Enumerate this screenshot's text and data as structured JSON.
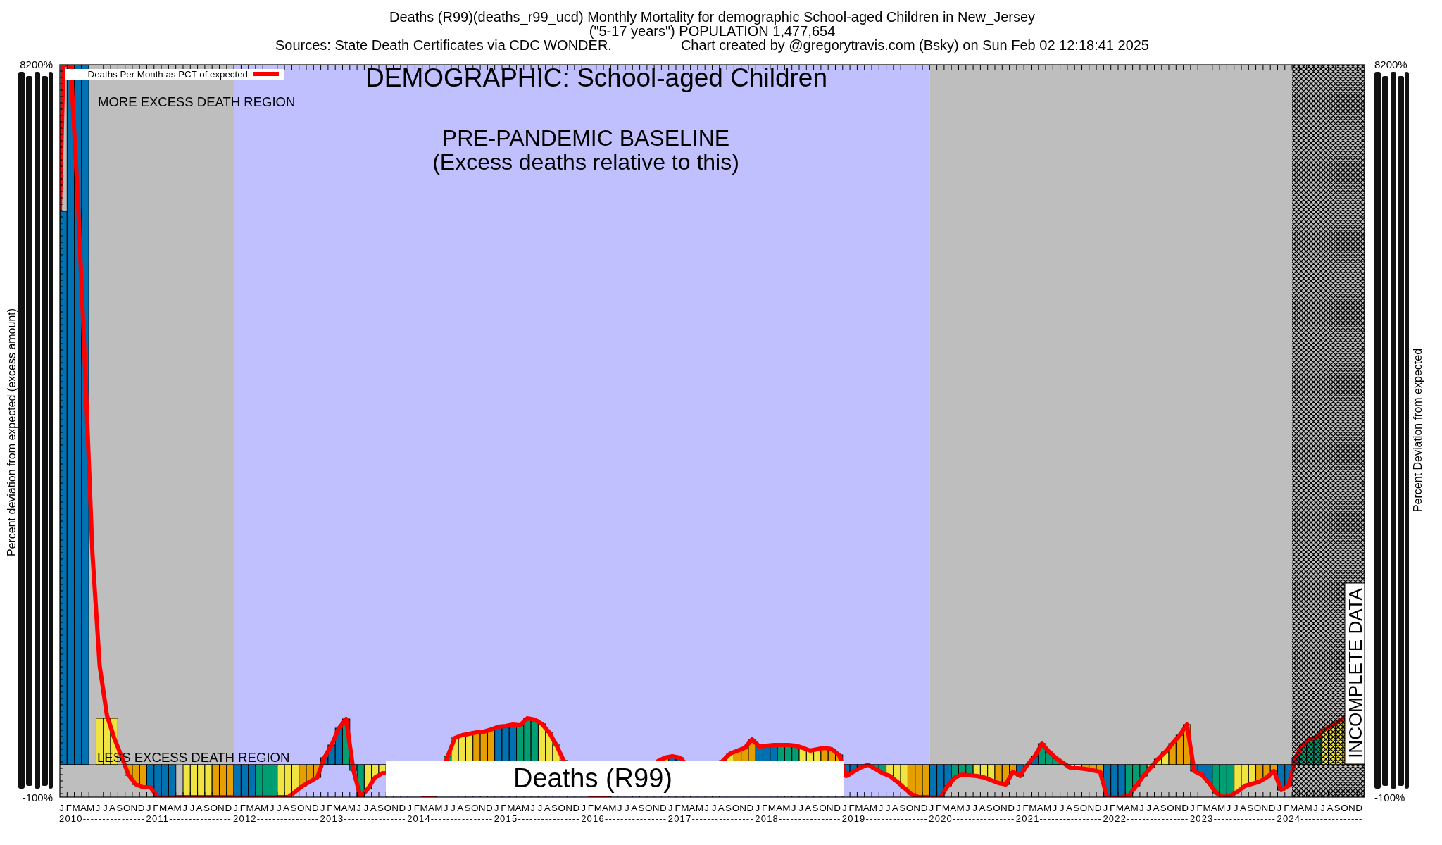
{
  "title": {
    "main": "Deaths (R99)(deaths_r99_ucd) Monthly Mortality for demographic School-aged Children in New_Jersey",
    "subtitle": "(\"5-17 years\") POPULATION 1,477,654",
    "sources": "Sources: State Death Certificates via CDC WONDER.",
    "credit": "Chart created by @gregorytravis.com (Bsky) on Sun Feb 02 12:18:41 2025"
  },
  "chart": {
    "legend": {
      "label": "Deaths Per Month as PCT of expected"
    },
    "heading": "DEMOGRAPHIC: School-aged Children",
    "notes": [
      {
        "kind": "upper",
        "text": "MORE EXCESS DEATH REGION"
      },
      {
        "kind": "baseline",
        "text": "PRE-PANDEMIC BASELINE"
      },
      {
        "kind": "baseline-sub",
        "text": "(Excess deaths relative to this)"
      },
      {
        "kind": "lower",
        "text": "LESS EXCESS DEATH REGION"
      },
      {
        "kind": "footer",
        "text": "Deaths (R99)"
      },
      {
        "kind": "incomplete",
        "text": "INCOMPLETE DATA"
      }
    ],
    "y_axis_left": {
      "title": "Percent deviation from expected (excess amount)",
      "ticks": [
        "8200%",
        "-100%"
      ]
    },
    "y_axis_right": {
      "title": "Percent Deviation from expected",
      "ticks": [
        "8200%",
        "-100%"
      ]
    },
    "x_axis": {
      "years": [
        {
          "label": "2010----------------",
          "months": [
            "J",
            "F",
            "M",
            "A",
            "M",
            "J",
            "J",
            "A",
            "S",
            "O",
            "N",
            "D"
          ]
        },
        {
          "label": "2011----------------",
          "months": [
            "J",
            "F",
            "M",
            "A",
            "M",
            "J",
            "J",
            "A",
            "S",
            "O",
            "N",
            "D"
          ]
        },
        {
          "label": "2012----------------",
          "months": [
            "J",
            "F",
            "M",
            "A",
            "M",
            "J",
            "J",
            "A",
            "S",
            "O",
            "N",
            "D"
          ]
        },
        {
          "label": "2013----------------",
          "months": [
            "J",
            "F",
            "M",
            "A",
            "M",
            "J",
            "J",
            "A",
            "S",
            "O",
            "N",
            "D"
          ]
        },
        {
          "label": "2014----------------",
          "months": [
            "J",
            "F",
            "M",
            "A",
            "M",
            "J",
            "J",
            "A",
            "S",
            "O",
            "N",
            "D"
          ]
        },
        {
          "label": "2015----------------",
          "months": [
            "J",
            "F",
            "M",
            "A",
            "M",
            "J",
            "J",
            "A",
            "S",
            "O",
            "N",
            "D"
          ]
        },
        {
          "label": "2016----------------",
          "months": [
            "J",
            "F",
            "M",
            "A",
            "M",
            "J",
            "J",
            "A",
            "S",
            "O",
            "N",
            "D"
          ]
        },
        {
          "label": "2017----------------",
          "months": [
            "J",
            "F",
            "M",
            "A",
            "M",
            "J",
            "J",
            "A",
            "S",
            "O",
            "N",
            "D"
          ]
        },
        {
          "label": "2018----------------",
          "months": [
            "J",
            "F",
            "M",
            "A",
            "M",
            "J",
            "J",
            "A",
            "S",
            "O",
            "N",
            "D"
          ]
        },
        {
          "label": "2019----------------",
          "months": [
            "J",
            "F",
            "M",
            "A",
            "M",
            "J",
            "J",
            "A",
            "S",
            "O",
            "N",
            "D"
          ]
        },
        {
          "label": "2020----------------",
          "months": [
            "J",
            "F",
            "M",
            "A",
            "M",
            "J",
            "J",
            "A",
            "S",
            "O",
            "N",
            "D"
          ]
        },
        {
          "label": "2021----------------",
          "months": [
            "J",
            "F",
            "M",
            "A",
            "M",
            "J",
            "J",
            "A",
            "S",
            "O",
            "N",
            "D"
          ]
        },
        {
          "label": "2022----------------",
          "months": [
            "J",
            "F",
            "M",
            "A",
            "M",
            "J",
            "J",
            "A",
            "S",
            "O",
            "N",
            "D"
          ]
        },
        {
          "label": "2023----------------",
          "months": [
            "J",
            "F",
            "M",
            "A",
            "M",
            "J",
            "J",
            "A",
            "S",
            "O",
            "N",
            "D"
          ]
        },
        {
          "label": "2024----------------",
          "months": [
            "J",
            "F",
            "M",
            "A",
            "M",
            "J",
            "J",
            "A",
            "S",
            "O",
            "N",
            "D"
          ]
        }
      ]
    }
  }
}
